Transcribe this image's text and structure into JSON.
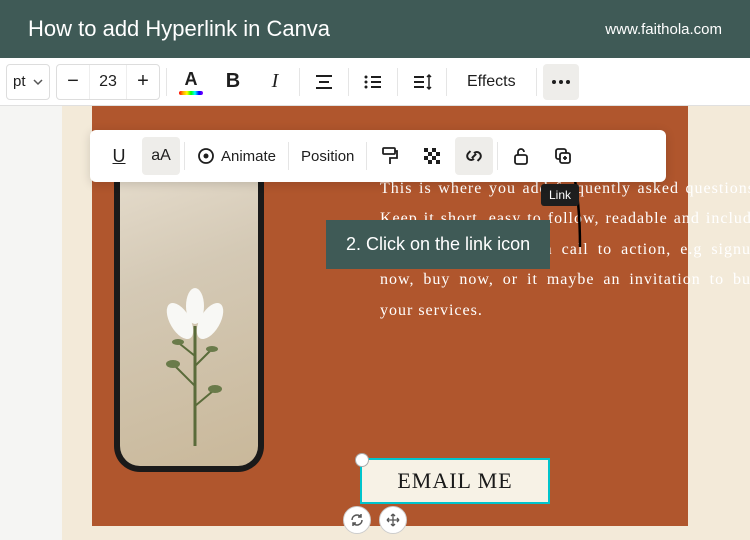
{
  "header": {
    "title": "How to add Hyperlink in Canva",
    "url": "www.faithola.com"
  },
  "toolbar1": {
    "font_abbrev": "pt",
    "font_size": "23",
    "text_color_letter": "A",
    "bold": "B",
    "italic": "I",
    "effects": "Effects"
  },
  "toolbar2": {
    "underline": "U",
    "case": "aA",
    "animate": "Animate",
    "position": "Position"
  },
  "tooltip": "Link",
  "instruction": "2. Click on the link icon",
  "canvas": {
    "body_text": "This is where you add frequently asked questions. Keep it short, easy to follow, readable and include actionable tips. Add a call to action, e.g signup now, buy now,  or it maybe an invitation to buy your services.",
    "cta": "EMAIL ME"
  }
}
